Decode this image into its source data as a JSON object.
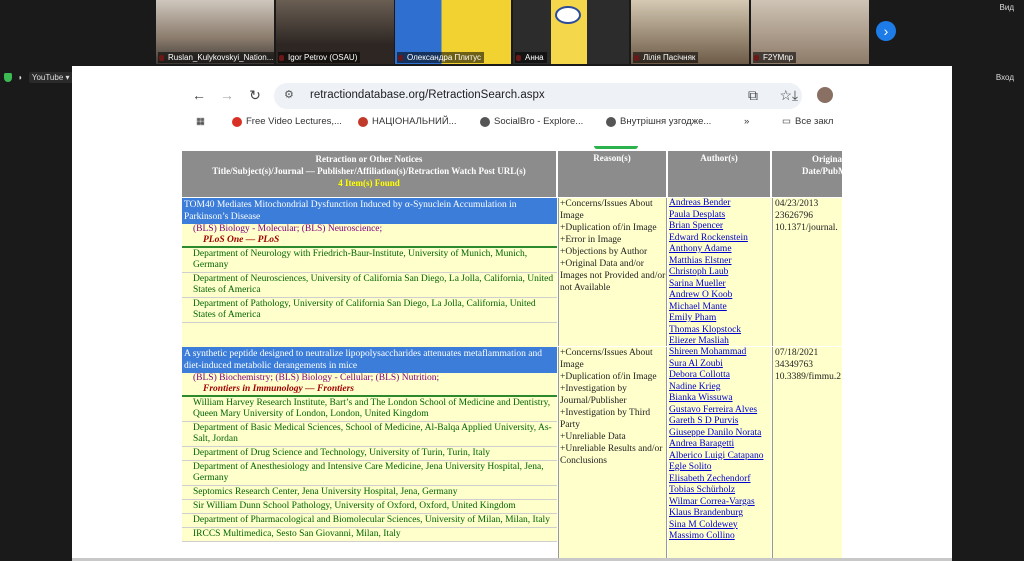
{
  "meeting": {
    "participants": [
      {
        "name": "Ruslan_Kulykovskyi_Nation..."
      },
      {
        "name": "Igor Petrov (OSAU)"
      },
      {
        "name": "Олександра Плитус"
      },
      {
        "name": "Анна"
      },
      {
        "name": "Лілія Пасічняк"
      },
      {
        "name": "F2YMnp"
      }
    ],
    "view_label": "Вид",
    "login_label": "Вход",
    "next_icon": "chevron-right-icon"
  },
  "youtube_label": "YouTube",
  "browser": {
    "url": "retractiondatabase.org/RetractionSearch.aspx",
    "bookmarks": [
      {
        "label": "Free Video Lectures,...",
        "color": "#d93025"
      },
      {
        "label": "НАЦІОНАЛЬНИЙ...",
        "color": "#c0392b"
      },
      {
        "label": "SocialBro - Explore...",
        "color": "#555555"
      },
      {
        "label": "Внутрішня узгодже...",
        "color": "#555555"
      }
    ],
    "more_label": "»",
    "all_bookmarks_label": "Все закл"
  },
  "table": {
    "header": {
      "main_line1": "Retraction or Other Notices",
      "main_line2": "Title/Subject(s)/Journal — Publisher/Affiliation(s)/Retraction Watch Post URL(s)",
      "found": "4 Item(s) Found",
      "reason": "Reason(s)",
      "author": "Author(s)",
      "date_line1": "Original",
      "date_line2": "Date/PubM"
    },
    "records": [
      {
        "title": "TOM40 Mediates Mitochondrial Dysfunction Induced by α-Synuclein Accumulation in Parkinson’s Disease",
        "subjects": "(BLS) Biology - Molecular; (BLS) Neuroscience;",
        "journal": "PLoS One",
        "publisher": "PLoS",
        "affiliations": [
          "Department of Neurology with Friedrich-Baur-Institute, University of Munich, Munich, Germany",
          "Department of Neurosciences, University of California San Diego, La Jolla, California, United States of America",
          "Department of Pathology, University of California San Diego, La Jolla, California, United States of America"
        ],
        "reasons": [
          "+Concerns/Issues About Image",
          "+Duplication of/in Image",
          "+Error in Image",
          "+Objections by Author",
          "+Original Data and/or Images not Provided and/or not Available"
        ],
        "authors": [
          "Andreas Bender",
          "Paula Desplats",
          "Brian Spencer",
          "Edward Rockenstein",
          "Anthony Adame",
          "Matthias Elstner",
          "Christoph Laub",
          "Sarina Mueller",
          "Andrew O Koob",
          "Michael Mante",
          "Emily Pham",
          "Thomas Klopstock",
          "Eliezer Masliah"
        ],
        "date": "04/23/2013",
        "pubmed": "23626796",
        "doi": "10.1371/journal."
      },
      {
        "title": "A synthetic peptide designed to neutralize lipopolysaccharides attenuates metaflammation and diet-induced metabolic derangements in mice",
        "subjects": "(BLS) Biochemistry; (BLS) Biology - Cellular; (BLS) Nutrition;",
        "journal": "Frontiers in Immunology",
        "publisher": "Frontiers",
        "affiliations": [
          "William Harvey Research Institute, Bart’s and The London School of Medicine and Dentistry, Queen Mary University of London, London, United Kingdom",
          "Department of Basic Medical Sciences, School of Medicine, Al-Balqa Applied University, As-Salt, Jordan",
          "Department of Drug Science and Technology, University of Turin, Turin, Italy",
          "Department of Anesthesiology and Intensive Care Medicine, Jena University Hospital, Jena, Germany",
          "Septomics Research Center, Jena University Hospital, Jena, Germany",
          "Sir William Dunn School Pathology, University of Oxford, Oxford, United Kingdom",
          "Department of Pharmacological and Biomolecular Sciences, University of Milan, Milan, Italy",
          "IRCCS Multimedica, Sesto San Giovanni, Milan, Italy"
        ],
        "reasons": [
          "+Concerns/Issues About Image",
          "+Duplication of/in Image",
          "+Investigation by Journal/Publisher",
          "+Investigation by Third Party",
          "+Unreliable Data",
          "+Unreliable Results and/or Conclusions"
        ],
        "authors": [
          "Shireen Mohammad",
          "Sura Al Zoubi",
          "Debora Collotta",
          "Nadine Krieg",
          "Bianka Wissuwa",
          "Gustavo Ferreira Alves",
          "Gareth S D Purvis",
          "Giuseppe Danilo Norata",
          "Andrea Baragetti",
          "Alberico Luigi Catapano",
          "Egle Solito",
          "Elisabeth Zechendorf",
          "Tobias Schürholz",
          "Wilmar Correa-Vargas",
          "Klaus Brandenburg",
          "Sina M Coldewey",
          "Massimo Collino"
        ],
        "date": "07/18/2021",
        "pubmed": "34349763",
        "doi": "10.3389/fimmu.2"
      }
    ]
  }
}
